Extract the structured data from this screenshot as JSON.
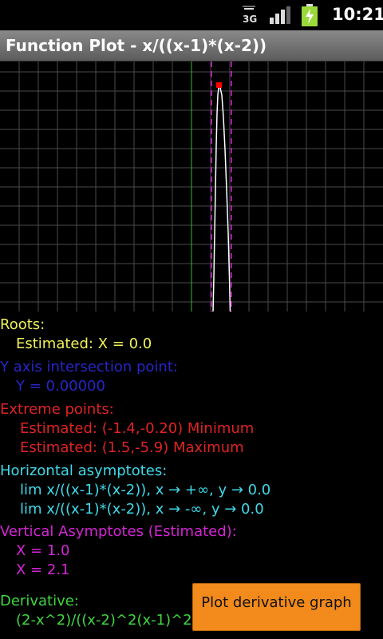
{
  "status_bar": {
    "network": "3G",
    "time": "10:21"
  },
  "title": "Function Plot - x/((x-1)*(x-2))",
  "roots": {
    "heading": "Roots:",
    "items": [
      "Estimated: X = 0.0"
    ]
  },
  "y_intersection": {
    "heading": "Y axis intersection point:",
    "items": [
      "Y = 0.00000"
    ]
  },
  "extreme_points": {
    "heading": "Extreme points:",
    "items": [
      "Estimated: (-1.4,-0.20) Minimum",
      "Estimated: (1.5,-5.9) Maximum"
    ]
  },
  "horizontal_asymptotes": {
    "heading": "Horizontal asymptotes:",
    "items": [
      "lim x/((x-1)*(x-2)), x → +∞, y → 0.0",
      "lim x/((x-1)*(x-2)), x → -∞, y → 0.0"
    ]
  },
  "vertical_asymptotes": {
    "heading": "Vertical Asymptotes (Estimated):",
    "items": [
      "X = 1.0",
      "X = 2.1"
    ]
  },
  "derivative": {
    "heading": "Derivative:",
    "expression": "(2-x^2)/((x-2)^2(x-1)^2)"
  },
  "plot_derivative_button": "Plot derivative graph",
  "colors": {
    "grid": "#4a4a4a",
    "y_axis": "#2fbf2f",
    "asymptote": "#d424d4",
    "curve": "#ffffff",
    "extreme_marker": "#ff0000",
    "button": "#f28a1c"
  }
}
